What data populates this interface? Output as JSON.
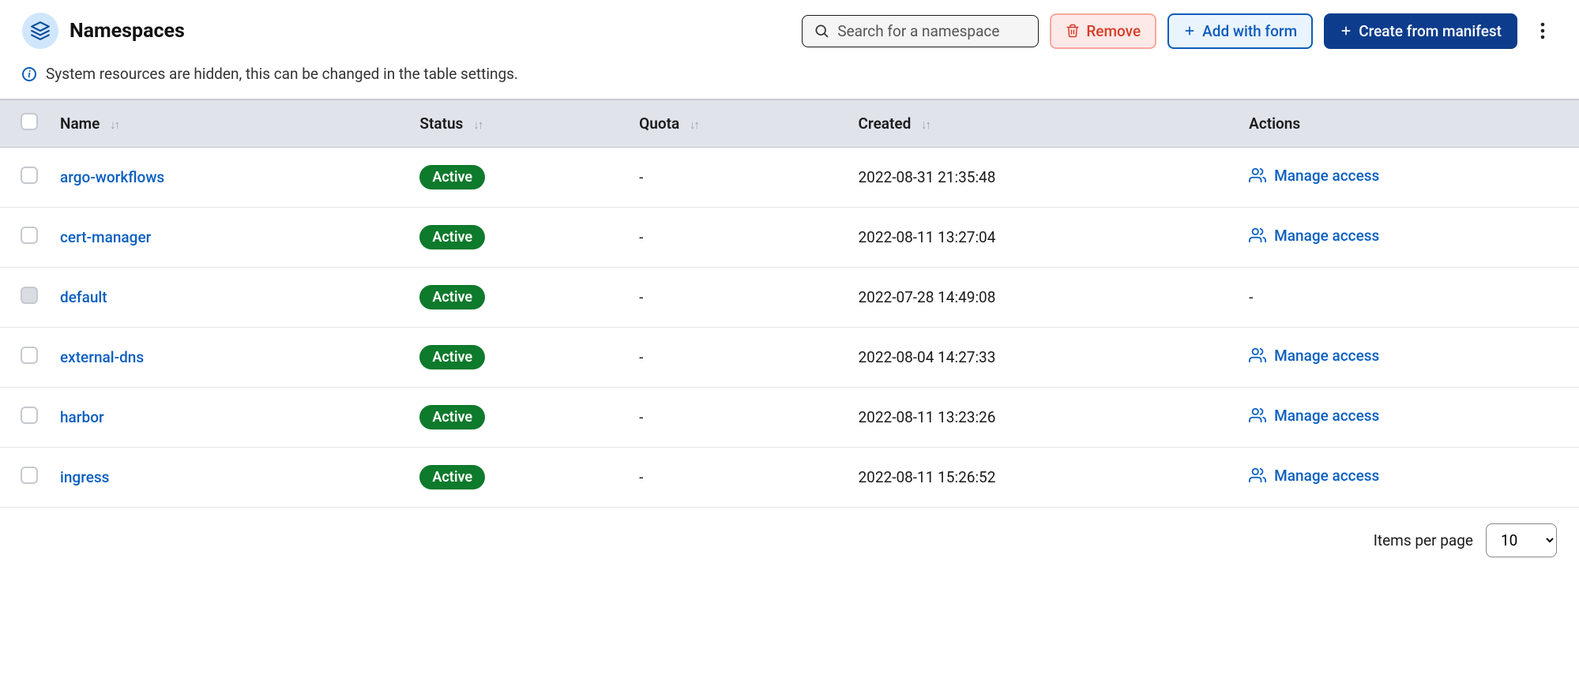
{
  "header": {
    "title": "Namespaces",
    "search_placeholder": "Search for a namespace",
    "remove_label": "Remove",
    "add_label": "Add with form",
    "create_label": "Create from manifest"
  },
  "banner": {
    "text": "System resources are hidden, this can be changed in the table settings."
  },
  "table": {
    "columns": {
      "name": "Name",
      "status": "Status",
      "quota": "Quota",
      "created": "Created",
      "actions": "Actions"
    },
    "manage_label": "Manage access",
    "rows": [
      {
        "name": "argo-workflows",
        "status": "Active",
        "quota": "-",
        "created": "2022-08-31 21:35:48",
        "has_manage": true,
        "disabled": false
      },
      {
        "name": "cert-manager",
        "status": "Active",
        "quota": "-",
        "created": "2022-08-11 13:27:04",
        "has_manage": true,
        "disabled": false
      },
      {
        "name": "default",
        "status": "Active",
        "quota": "-",
        "created": "2022-07-28 14:49:08",
        "has_manage": false,
        "disabled": true
      },
      {
        "name": "external-dns",
        "status": "Active",
        "quota": "-",
        "created": "2022-08-04 14:27:33",
        "has_manage": true,
        "disabled": false
      },
      {
        "name": "harbor",
        "status": "Active",
        "quota": "-",
        "created": "2022-08-11 13:23:26",
        "has_manage": true,
        "disabled": false
      },
      {
        "name": "ingress",
        "status": "Active",
        "quota": "-",
        "created": "2022-08-11 15:26:52",
        "has_manage": true,
        "disabled": false
      }
    ]
  },
  "footer": {
    "items_label": "Items per page",
    "page_size": "10"
  }
}
